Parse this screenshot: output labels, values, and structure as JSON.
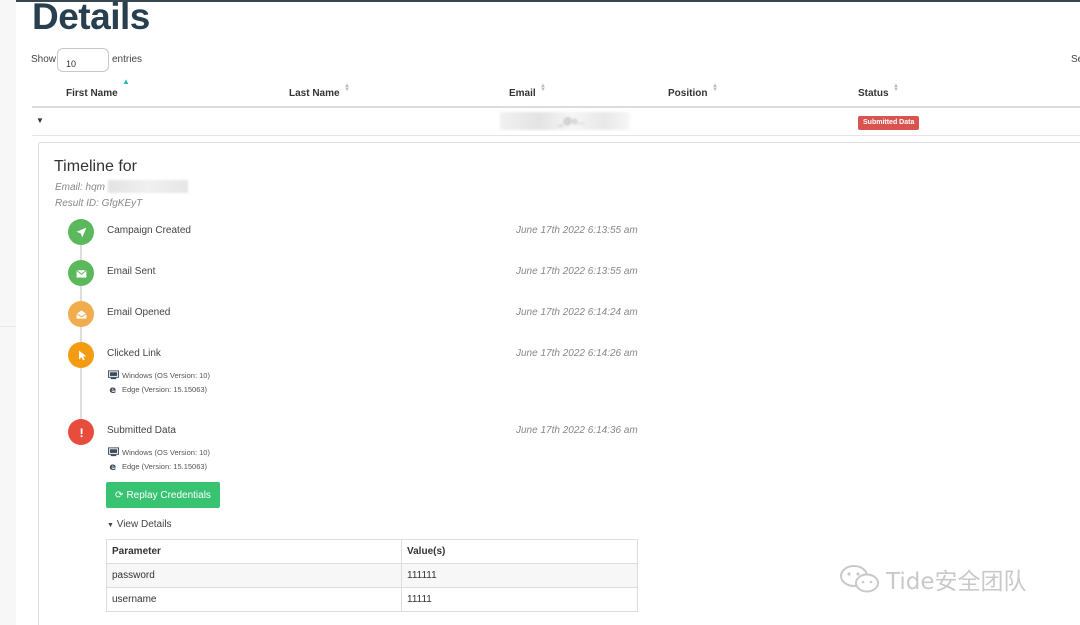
{
  "page": {
    "title": "Details"
  },
  "table_controls": {
    "show_label": "Show",
    "page_size": "10",
    "entries_label": "entries",
    "search_label_partial": "Se"
  },
  "table": {
    "columns": [
      "First Name",
      "Last Name",
      "Email",
      "Position",
      "Status"
    ],
    "sorted_column": "First Name",
    "row": {
      "email_partial": "_@o...",
      "status": "Submitted Data",
      "status_color": "#d9534f"
    }
  },
  "timeline": {
    "title": "Timeline for",
    "email_label": "Email: hqm",
    "result_id_label": "Result ID: GfgKEyT",
    "events": [
      {
        "label": "Campaign Created",
        "time": "June 17th 2022 6:13:55 am",
        "icon": "rocket-icon",
        "color": "#5cb85c"
      },
      {
        "label": "Email Sent",
        "time": "June 17th 2022 6:13:55 am",
        "icon": "envelope-icon",
        "color": "#5cb85c"
      },
      {
        "label": "Email Opened",
        "time": "June 17th 2022 6:14:24 am",
        "icon": "envelope-open-icon",
        "color": "#f0ad4e"
      },
      {
        "label": "Clicked Link",
        "time": "June 17th 2022 6:14:26 am",
        "icon": "cursor-icon",
        "color": "#f39c12",
        "os": "Windows (OS Version: 10)",
        "browser": "Edge (Version: 15.15063)"
      },
      {
        "label": "Submitted Data",
        "time": "June 17th 2022 6:14:36 am",
        "icon": "exclamation-icon",
        "color": "#e74c3c",
        "os": "Windows (OS Version: 10)",
        "browser": "Edge (Version: 15.15063)"
      }
    ],
    "replay_button": "Replay Credentials",
    "replay_color": "#37c372",
    "view_details": "View Details",
    "details_table": {
      "headers": [
        "Parameter",
        "Value(s)"
      ],
      "rows": [
        [
          "password",
          "111111"
        ],
        [
          "username",
          "11111"
        ]
      ]
    }
  },
  "watermark": {
    "text": "Tide安全团队"
  }
}
